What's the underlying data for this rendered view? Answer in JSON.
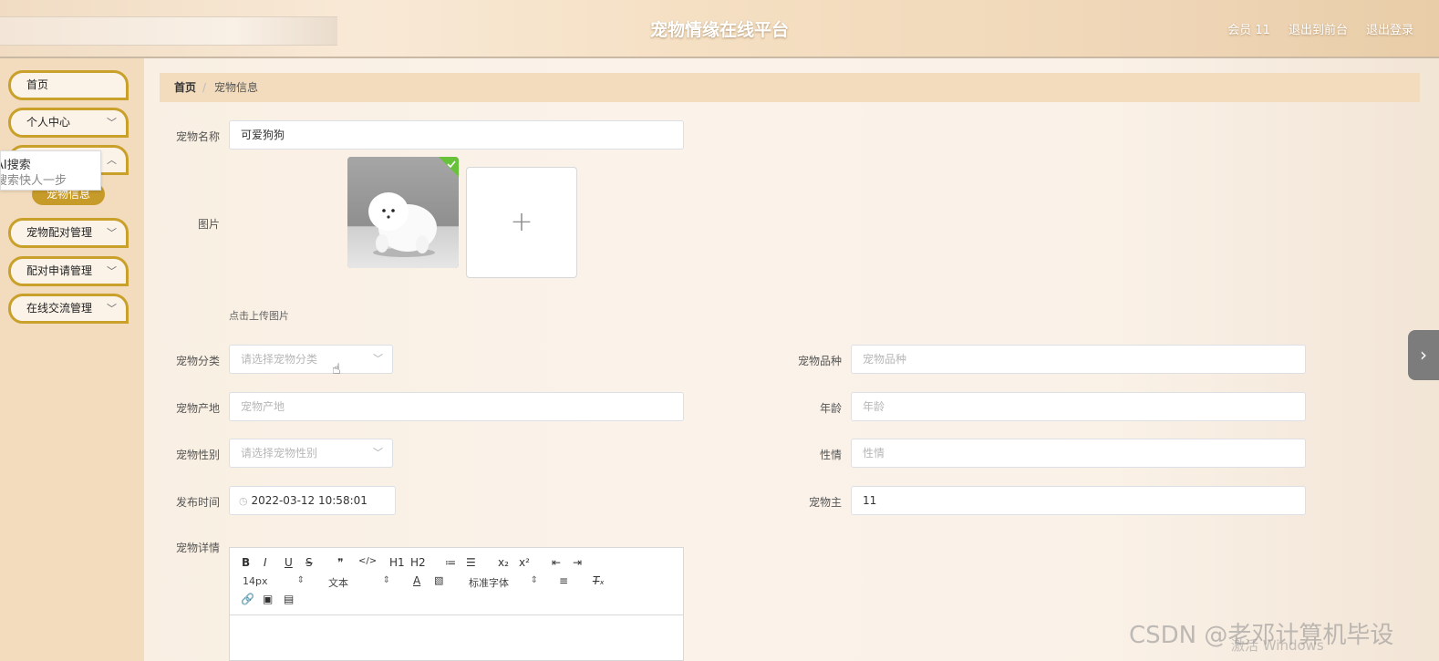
{
  "header": {
    "title": "宠物情缘在线平台",
    "links": [
      "会员 11",
      "退出到前台",
      "退出登录"
    ]
  },
  "sidebar": {
    "items": [
      {
        "label": "首页",
        "chevron": false
      },
      {
        "label": "个人中心",
        "chevron": true
      },
      {
        "label": "",
        "chevron": true
      },
      {
        "label": "宠物配对管理",
        "chevron": true
      },
      {
        "label": "配对申请管理",
        "chevron": true
      },
      {
        "label": "在线交流管理",
        "chevron": true
      }
    ],
    "active_sub": "宠物信息",
    "ai_tip": {
      "line1": "AI搜索",
      "line2": "搜索快人一步"
    }
  },
  "breadcrumb": {
    "home": "首页",
    "sep": "/",
    "current": "宠物信息"
  },
  "form": {
    "name_label": "宠物名称",
    "name_value": "可爱狗狗",
    "image_label": "图片",
    "upload_tip": "点击上传图片",
    "upload_plus": "+",
    "category_label": "宠物分类",
    "category_placeholder": "请选择宠物分类",
    "breed_label": "宠物品种",
    "breed_placeholder": "宠物品种",
    "origin_label": "宠物产地",
    "origin_placeholder": "宠物产地",
    "age_label": "年龄",
    "age_placeholder": "年龄",
    "gender_label": "宠物性别",
    "gender_placeholder": "请选择宠物性别",
    "temper_label": "性情",
    "temper_placeholder": "性情",
    "time_label": "发布时间",
    "time_value": "2022-03-12 10:58:01",
    "owner_label": "宠物主",
    "owner_value": "11",
    "details_label": "宠物详情"
  },
  "editor": {
    "row1": [
      "B",
      "I",
      "U",
      "S",
      "❞",
      "</>",
      "H1",
      "H2",
      "≔",
      "☰",
      "x₂",
      "x²",
      "⇤",
      "⇥"
    ],
    "size": "14px",
    "style": "文本",
    "font": "标准字体"
  },
  "watermark": "CSDN @老邓计算机毕设",
  "activate": "激活 Windows"
}
